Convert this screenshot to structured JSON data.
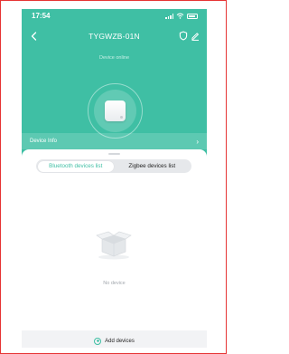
{
  "status_bar": {
    "time": "17:54"
  },
  "nav": {
    "title": "TYGWZB-01N"
  },
  "device": {
    "status": "Device online"
  },
  "info_bar": {
    "label": "Device Info",
    "chevron": "›"
  },
  "tabs": [
    {
      "label": "Bluetooth devices list",
      "active": true
    },
    {
      "label": "Zigbee devices list",
      "active": false
    }
  ],
  "empty": {
    "text": "No device"
  },
  "add": {
    "label": "Add devices"
  },
  "colors": {
    "accent": "#3fbfa4",
    "frame": "#e63434"
  }
}
